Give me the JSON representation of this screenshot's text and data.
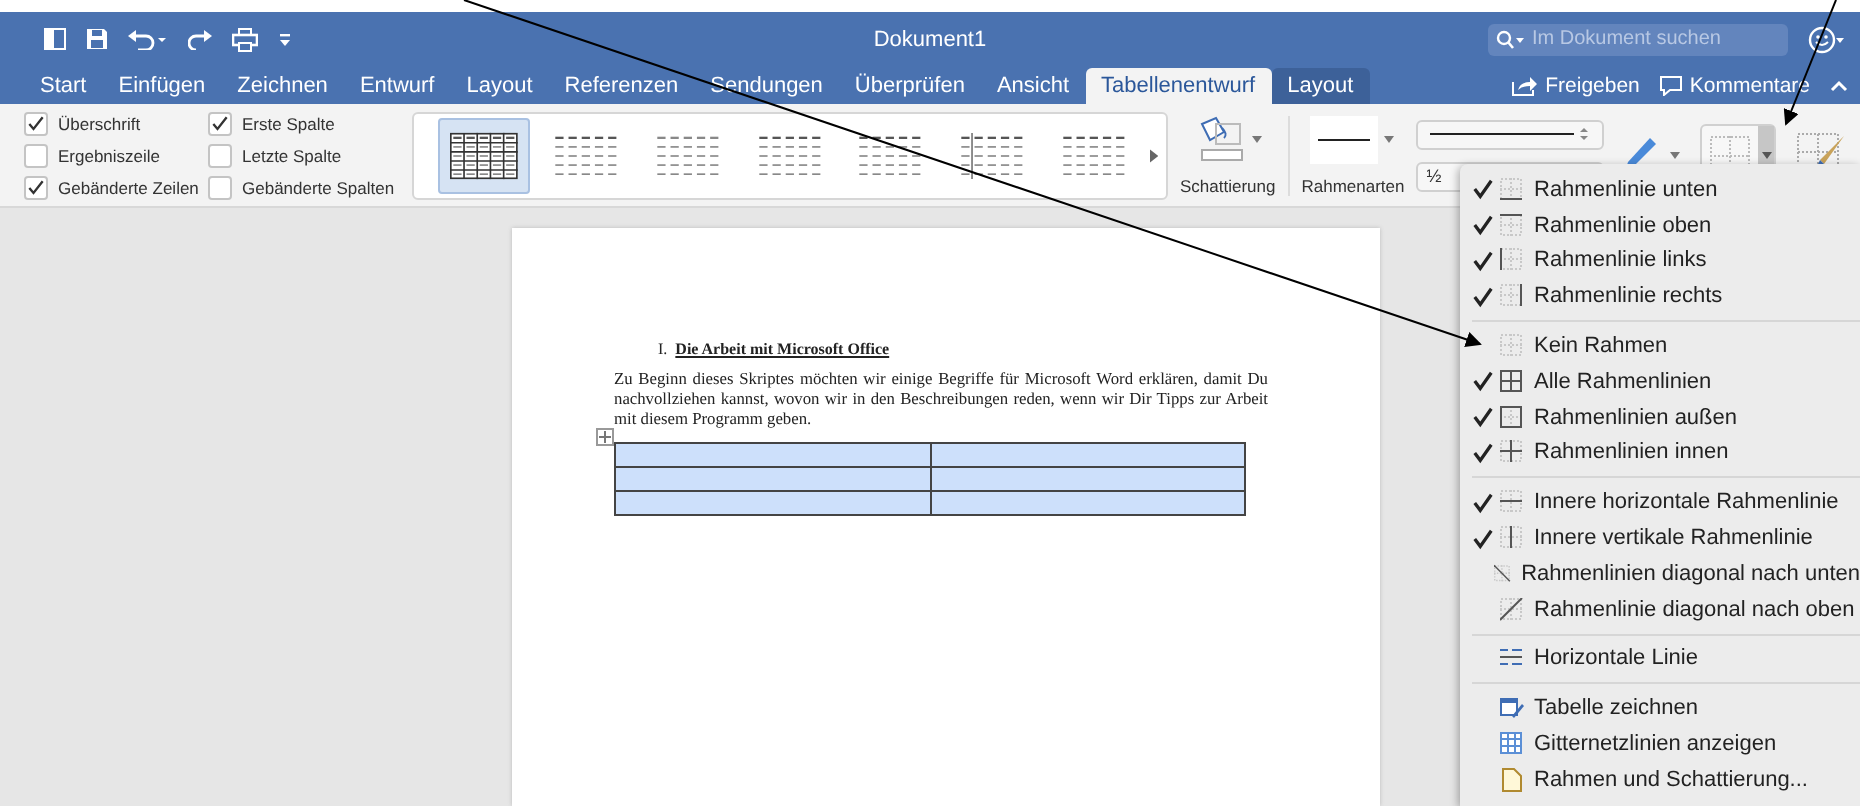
{
  "window": {
    "title": "Dokument1"
  },
  "search": {
    "placeholder": "Im Dokument suchen"
  },
  "tabs": [
    {
      "label": "Start",
      "selected": false
    },
    {
      "label": "Einfügen",
      "selected": false
    },
    {
      "label": "Zeichnen",
      "selected": false
    },
    {
      "label": "Entwurf",
      "selected": false
    },
    {
      "label": "Layout",
      "selected": false
    },
    {
      "label": "Referenzen",
      "selected": false
    },
    {
      "label": "Sendungen",
      "selected": false
    },
    {
      "label": "Überprüfen",
      "selected": false
    },
    {
      "label": "Ansicht",
      "selected": false
    },
    {
      "label": "Tabellenentwurf",
      "selected": true
    },
    {
      "label": "Layout",
      "selected": false,
      "kind": "context"
    }
  ],
  "ribbon_actions": [
    {
      "label": "Freigeben",
      "kind": "share"
    },
    {
      "label": "Kommentare",
      "kind": "comment"
    }
  ],
  "style_options": [
    {
      "label": "Überschrift",
      "checked": true
    },
    {
      "label": "Ergebniszeile",
      "checked": false
    },
    {
      "label": "Gebänderte Zeilen",
      "checked": true
    },
    {
      "label": "Erste Spalte",
      "checked": true
    },
    {
      "label": "Letzte Spalte",
      "checked": false
    },
    {
      "label": "Gebänderte Spalten",
      "checked": false
    }
  ],
  "table_styles": [
    {
      "selected": true
    },
    {
      "selected": false
    },
    {
      "selected": false
    },
    {
      "selected": false
    },
    {
      "selected": false
    },
    {
      "selected": false
    },
    {
      "selected": false
    }
  ],
  "shading": {
    "label": "Schattierung"
  },
  "border_styles": {
    "label": "Rahmenarten"
  },
  "line_weight": {
    "value": "½"
  },
  "document": {
    "heading_number": "I.",
    "heading": "Die Arbeit mit Microsoft Office",
    "paragraph": "Zu Beginn dieses Skriptes möchten wir einige Begriffe für Microsoft Word erklären, damit Du nachvollziehen kannst, wovon wir in den Beschreibungen reden, wenn wir Dir Tipps zur Arbeit mit diesem Programm geben."
  },
  "border_menu": [
    {
      "label": "Rahmenlinie unten",
      "checked": true,
      "kind": "bottom"
    },
    {
      "label": "Rahmenlinie oben",
      "checked": true,
      "kind": "top"
    },
    {
      "label": "Rahmenlinie links",
      "checked": true,
      "kind": "left"
    },
    {
      "label": "Rahmenlinie rechts",
      "checked": true,
      "kind": "right",
      "group_end": true
    },
    {
      "label": "Kein Rahmen",
      "checked": false,
      "kind": "none"
    },
    {
      "label": "Alle Rahmenlinien",
      "checked": true,
      "kind": "all"
    },
    {
      "label": "Rahmenlinien außen",
      "checked": true,
      "kind": "outside"
    },
    {
      "label": "Rahmenlinien innen",
      "checked": true,
      "kind": "inside",
      "group_end": true
    },
    {
      "label": "Innere horizontale Rahmenlinie",
      "checked": true,
      "kind": "inside-h"
    },
    {
      "label": "Innere vertikale Rahmenlinie",
      "checked": true,
      "kind": "inside-v"
    },
    {
      "label": "Rahmenlinien diagonal nach unten",
      "checked": false,
      "kind": "diag-down"
    },
    {
      "label": "Rahmenlinie diagonal nach oben",
      "checked": false,
      "kind": "diag-up",
      "group_end": true
    },
    {
      "label": "Horizontale Linie",
      "checked": false,
      "kind": "hline",
      "group_end": true
    },
    {
      "label": "Tabelle zeichnen",
      "checked": false,
      "kind": "draw-table"
    },
    {
      "label": "Gitternetzlinien anzeigen",
      "checked": false,
      "kind": "gridlines"
    },
    {
      "label": "Rahmen und Schattierung...",
      "checked": false,
      "kind": "dialog"
    }
  ]
}
